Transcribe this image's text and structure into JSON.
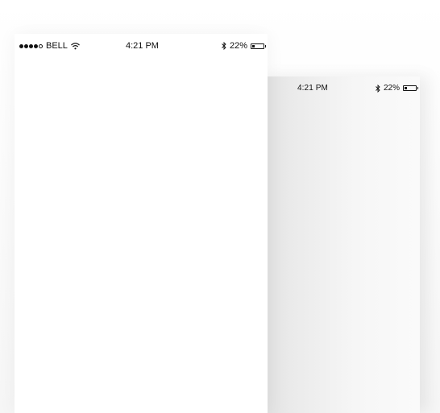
{
  "screens": [
    {
      "status_bar": {
        "signal_dots": 5,
        "signal_filled": 4,
        "carrier": "BELL",
        "wifi_icon": "wifi-icon",
        "time": "4:21 PM",
        "bluetooth_icon": "bluetooth-icon",
        "battery_percent": "22%",
        "battery_level": 0.22
      }
    },
    {
      "status_bar": {
        "time": "4:21 PM",
        "bluetooth_icon": "bluetooth-icon",
        "battery_percent": "22%",
        "battery_level": 0.22
      }
    }
  ],
  "colors": {
    "screen_front": "#ffffff",
    "screen_back": "#eeeeee",
    "status_text": "#111111"
  }
}
